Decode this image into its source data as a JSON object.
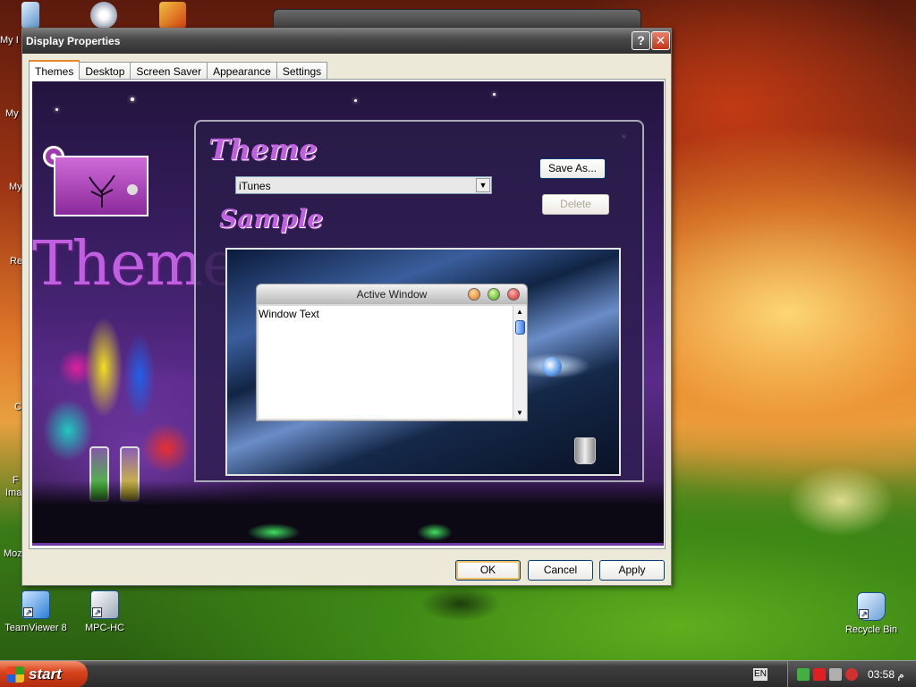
{
  "window": {
    "title": "Display Properties",
    "help_label": "?",
    "close_label": "✕"
  },
  "tabs": [
    {
      "label": "Themes",
      "active": true
    },
    {
      "label": "Desktop"
    },
    {
      "label": "Screen Saver"
    },
    {
      "label": "Appearance"
    },
    {
      "label": "Settings"
    }
  ],
  "themes_panel": {
    "banner_text": "Themes",
    "theme_label": "Theme",
    "selected_theme": "iTunes",
    "save_as_label": "Save As...",
    "delete_label": "Delete",
    "sample_label": "Sample",
    "sample_window": {
      "title": "Active Window",
      "body_text": "Window Text"
    }
  },
  "footer_buttons": {
    "ok": "OK",
    "cancel": "Cancel",
    "apply": "Apply"
  },
  "desktop_icons": [
    {
      "label": "TeamViewer 8"
    },
    {
      "label": "MPC-HC"
    },
    {
      "label": "Recycle Bin"
    }
  ],
  "left_partial_labels": [
    "My I",
    "My",
    "My",
    "Re",
    "C",
    "F",
    "Ima",
    "Moz"
  ],
  "taskbar": {
    "start_label": "start",
    "language": "EN",
    "clock": "03:58  م"
  },
  "colors": {
    "accent_tab": "#e68b2c",
    "close_button": "#c03418",
    "start_button": "#d8441e",
    "panel_purple": "#3c1f66"
  }
}
